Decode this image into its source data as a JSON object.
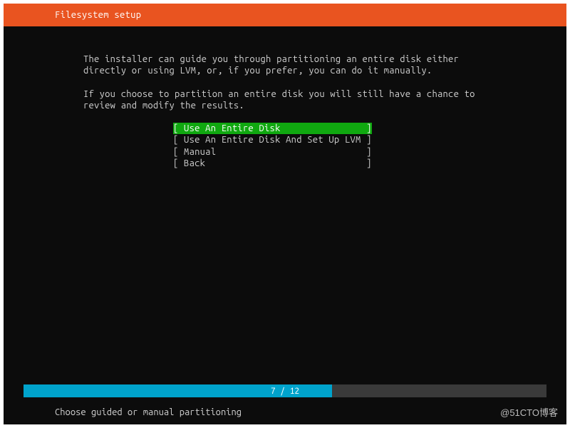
{
  "header": {
    "title": "Filesystem setup"
  },
  "body": {
    "para1": "The installer can guide you through partitioning an entire disk either directly or using LVM, or, if you prefer, you can do it manually.",
    "para2": "If you choose to partition an entire disk you will still have a chance to review and modify the results."
  },
  "menu": {
    "items": [
      {
        "label": "[ Use An Entire Disk                ]",
        "selected": true
      },
      {
        "label": "[ Use An Entire Disk And Set Up LVM ]",
        "selected": false
      },
      {
        "label": "[ Manual                            ]",
        "selected": false
      },
      {
        "label": "[ Back                              ]",
        "selected": false
      }
    ]
  },
  "progress": {
    "current": 7,
    "total": 12,
    "label": "7 / 12"
  },
  "footer": {
    "hint": "Choose guided or manual partitioning"
  },
  "watermark": "@51CTO博客"
}
